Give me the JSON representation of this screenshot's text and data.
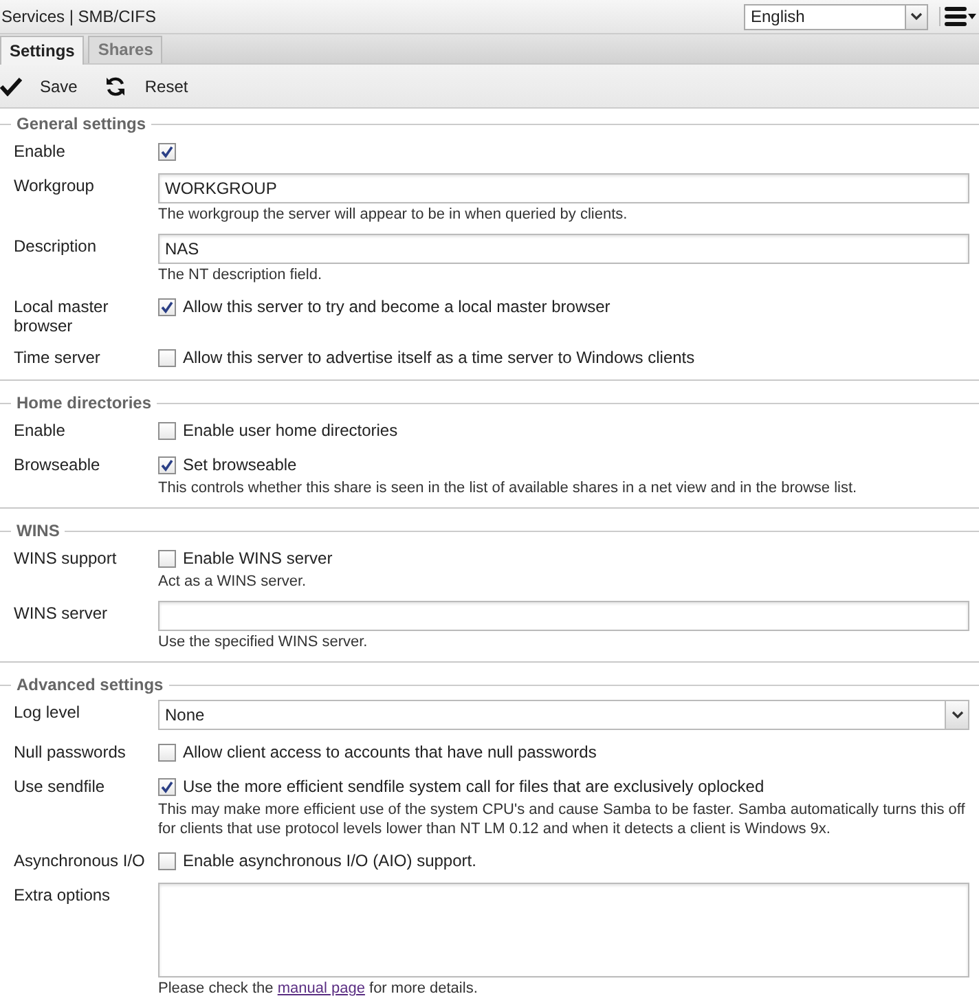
{
  "header": {
    "breadcrumb": "Services | SMB/CIFS",
    "language": "English"
  },
  "tabs": [
    {
      "label": "Settings",
      "selected": true
    },
    {
      "label": "Shares",
      "selected": false
    }
  ],
  "toolbar": [
    {
      "kind": "save",
      "label": "Save"
    },
    {
      "kind": "reset",
      "label": "Reset"
    }
  ],
  "sections": [
    {
      "title": "General settings",
      "fields": [
        {
          "kind": "checkbox",
          "label": "Enable",
          "checked": true
        },
        {
          "kind": "text",
          "label": "Workgroup",
          "value": "WORKGROUP",
          "hint": "The workgroup the server will appear to be in when queried by clients."
        },
        {
          "kind": "text",
          "label": "Description",
          "value": "NAS",
          "hint": "The NT description field."
        },
        {
          "kind": "checkbox",
          "label": "Local master browser",
          "checked": true,
          "caption": "Allow this server to try and become a local master browser"
        },
        {
          "kind": "checkbox",
          "label": "Time server",
          "checked": false,
          "caption": "Allow this server to advertise itself as a time server to Windows clients"
        }
      ]
    },
    {
      "title": "Home directories",
      "fields": [
        {
          "kind": "checkbox",
          "label": "Enable",
          "checked": false,
          "caption": "Enable user home directories"
        },
        {
          "kind": "checkbox",
          "label": "Browseable",
          "checked": true,
          "caption": "Set browseable",
          "hint": "This controls whether this share is seen in the list of available shares in a net view and in the browse list."
        }
      ]
    },
    {
      "title": "WINS",
      "fields": [
        {
          "kind": "checkbox",
          "label": "WINS support",
          "checked": false,
          "caption": "Enable WINS server",
          "hint": "Act as a WINS server."
        },
        {
          "kind": "text",
          "label": "WINS server",
          "hint": "Use the specified WINS server."
        }
      ]
    },
    {
      "title": "Advanced settings",
      "fields": [
        {
          "kind": "select",
          "label": "Log level",
          "value": "None"
        },
        {
          "kind": "checkbox",
          "label": "Null passwords",
          "checked": false,
          "caption": "Allow client access to accounts that have null passwords"
        },
        {
          "kind": "checkbox",
          "label": "Use sendfile",
          "checked": true,
          "caption": "Use the more efficient sendfile system call for files that are exclusively oplocked",
          "hint": "This may make more efficient use of the system CPU's and cause Samba to be faster. Samba automatically turns this off for clients that use protocol levels lower than NT LM 0.12 and when it detects a client is Windows 9x."
        },
        {
          "kind": "checkbox",
          "label": "Asynchronous I/O",
          "checked": false,
          "caption": "Enable asynchronous I/O (AIO) support."
        },
        {
          "kind": "textarea",
          "label": "Extra options",
          "hint_link": {
            "before": "Please check the",
            "link": "manual page",
            "after": "for more details."
          }
        }
      ]
    }
  ]
}
